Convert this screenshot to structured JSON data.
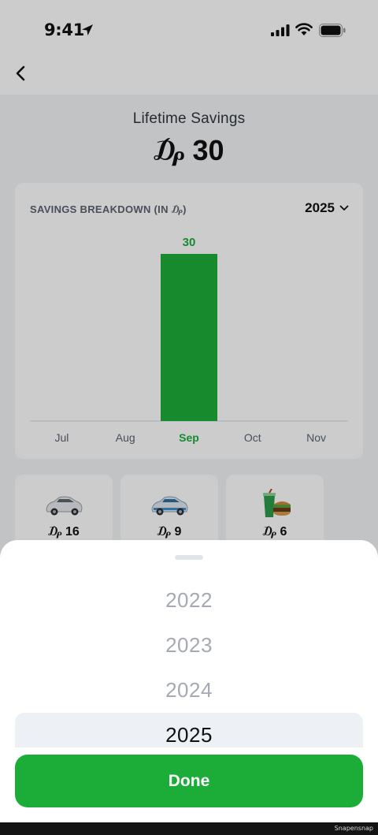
{
  "status": {
    "time": "9:41"
  },
  "header": {
    "title": "Lifetime Savings",
    "amount": "₯ 30"
  },
  "card": {
    "title": "SAVINGS BREAKDOWN (IN ₯)",
    "selected_year": "2025"
  },
  "chart_data": {
    "type": "bar",
    "categories": [
      "Jul",
      "Aug",
      "Sep",
      "Oct",
      "Nov"
    ],
    "values": [
      0,
      0,
      30,
      0,
      0
    ],
    "highlight": "Sep",
    "data_labels": [
      "",
      "",
      "30",
      "",
      ""
    ],
    "bar_color": "#1cad39"
  },
  "categories": [
    {
      "icon": "car-icon",
      "value": "₯ 16"
    },
    {
      "icon": "car-blue-icon",
      "value": "₯ 9"
    },
    {
      "icon": "food-icon",
      "value": "₯ 6"
    }
  ],
  "picker": {
    "years": [
      "2022",
      "2023",
      "2024",
      "2025"
    ],
    "selected": "2025",
    "done_label": "Done"
  },
  "watermark": "Snapensnap",
  "colors": {
    "accent": "#1cad39",
    "muted": "#a5aab2"
  }
}
